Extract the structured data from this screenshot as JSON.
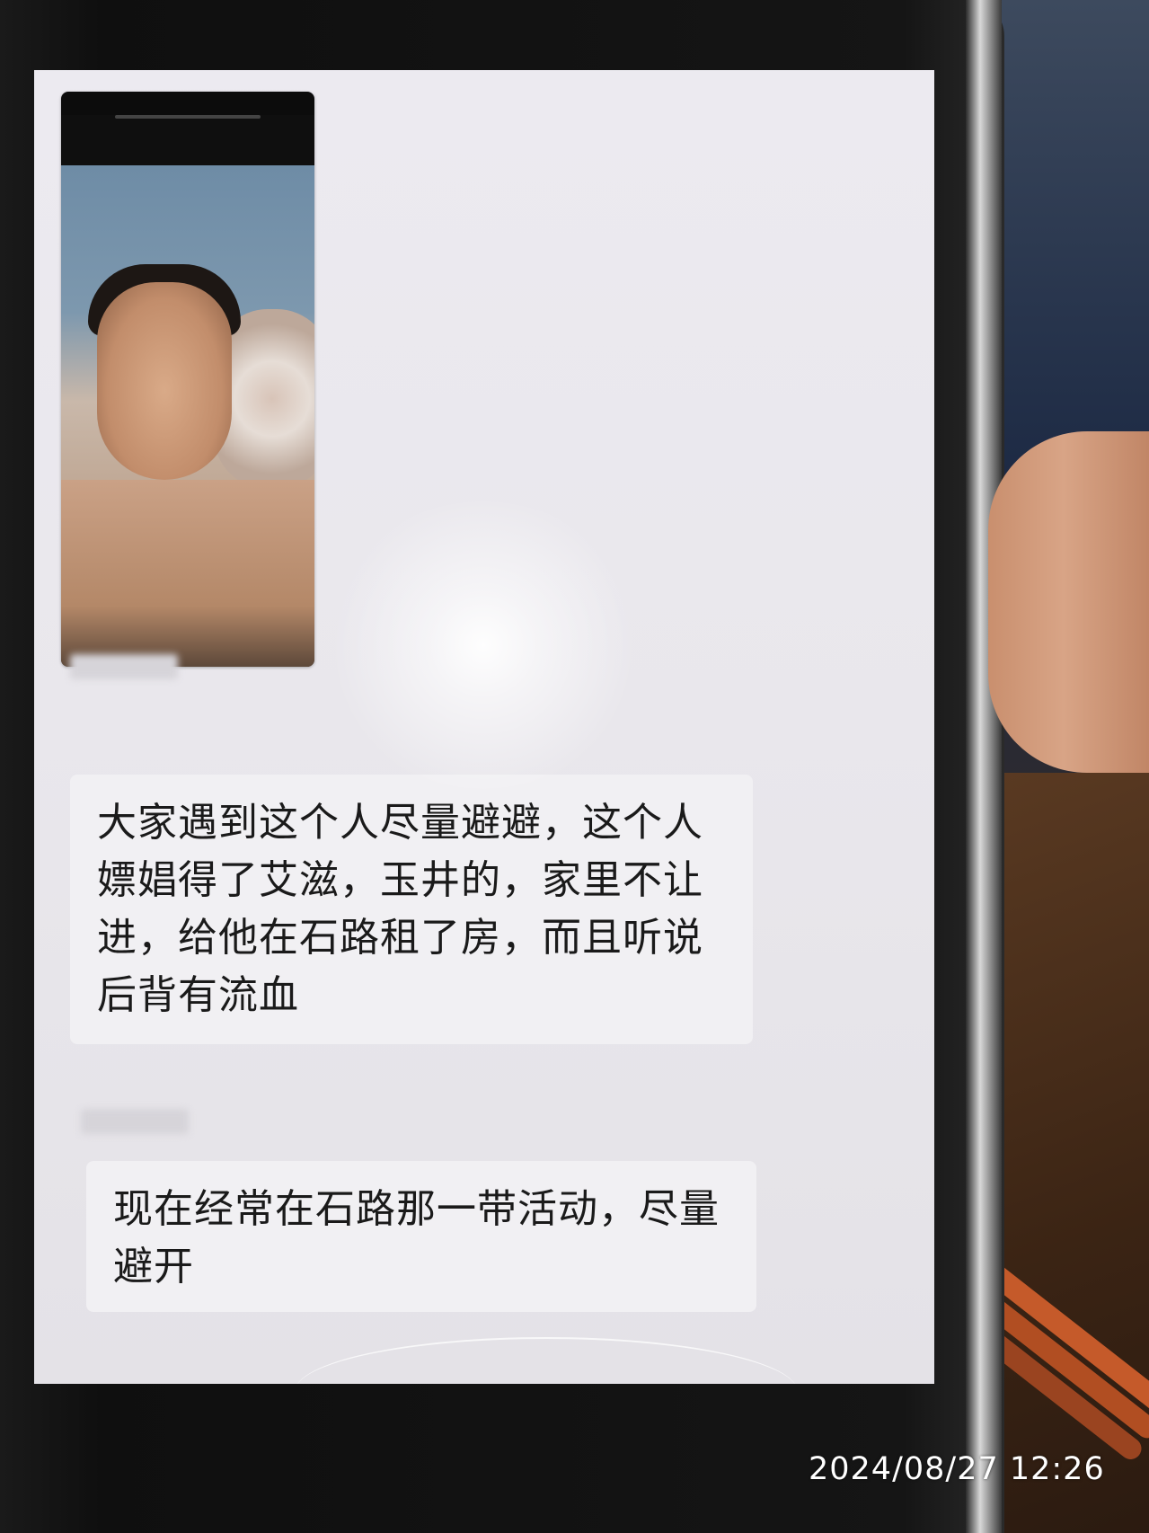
{
  "chat": {
    "messages": [
      {
        "type": "image",
        "sender": "",
        "text": ""
      },
      {
        "type": "text",
        "sender": "",
        "text": "大家遇到这个人尽量避避，这个人嫖娼得了艾滋，玉井的，家里不让进，给他在石路租了房，而且听说后背有流血"
      },
      {
        "type": "text",
        "sender": "",
        "text": "现在经常在石路那一带活动，尽量避开"
      }
    ]
  },
  "photo_overlay": {
    "timestamp": "2024/08/27 12:26"
  }
}
